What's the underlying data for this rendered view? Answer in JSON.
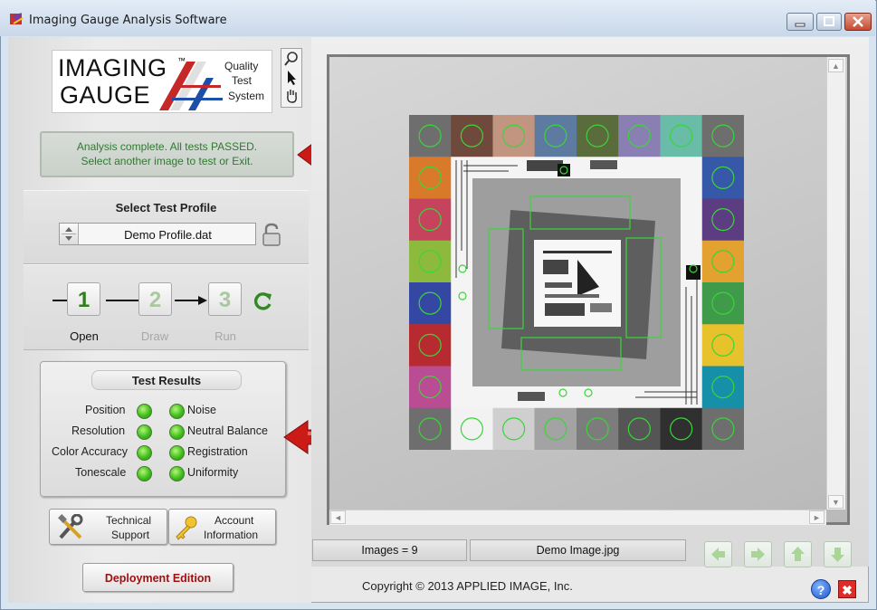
{
  "window": {
    "title": "Imaging Gauge Analysis Software",
    "colors": {
      "pass_green": "#2f7a2f",
      "deploy_red": "#a01010",
      "arrow_red": "#cc1a16"
    }
  },
  "logo": {
    "line1": "IMAGING",
    "tm": "™",
    "line2": "GAUGE",
    "tag1": "Quality",
    "tag2": "Test",
    "tag3": "System"
  },
  "tools": [
    "magnifier-icon",
    "pointer-icon",
    "hand-icon"
  ],
  "status": {
    "line1": "Analysis complete.  All tests PASSED.",
    "line2": "Select another image to test or Exit."
  },
  "profile": {
    "title": "Select Test Profile",
    "value": "Demo Profile.dat"
  },
  "steps": [
    {
      "num": "1",
      "label": "Open",
      "active": true
    },
    {
      "num": "2",
      "label": "Draw",
      "active": false
    },
    {
      "num": "3",
      "label": "Run",
      "active": false
    }
  ],
  "results": {
    "title": "Test Results",
    "left": [
      "Position",
      "Resolution",
      "Color Accuracy",
      "Tonescale"
    ],
    "right": [
      "Noise",
      "Neutral Balance",
      "Registration",
      "Uniformity"
    ]
  },
  "buttons": {
    "tech_line1": "Technical",
    "tech_line2": "Support",
    "acct_line1": "Account",
    "acct_line2": "Information",
    "deploy": "Deployment Edition"
  },
  "statusbar": {
    "images": "Images = 9",
    "filename": "Demo Image.jpg"
  },
  "footer": {
    "copyright": "Copyright © 2013 APPLIED IMAGE, Inc.",
    "help": "?",
    "exit": "✖"
  },
  "nav": [
    "arrow-left-icon",
    "arrow-right-icon",
    "arrow-up-icon",
    "arrow-down-icon"
  ],
  "chart_target": {
    "top_row": [
      "#6e6e6e",
      "#6f4a3c",
      "#c29581",
      "#5d7aa0",
      "#5a6b3c",
      "#8a7fb2",
      "#69bca8",
      "#6e6e6e"
    ],
    "bottom_row": [
      "#6e6e6e",
      "#f2f2f2",
      "#cfcfcf",
      "#a3a3a3",
      "#7c7c7c",
      "#555555",
      "#2f2f2f",
      "#6e6e6e"
    ],
    "left_col": [
      "#d97a2a",
      "#c5435c",
      "#8dba3c",
      "#3448a3",
      "#b72a2f",
      "#b94c92"
    ],
    "right_col": [
      "#3558a8",
      "#5c3d82",
      "#e3a12f",
      "#3f9a4a",
      "#e7c22a",
      "#168fa8"
    ]
  }
}
